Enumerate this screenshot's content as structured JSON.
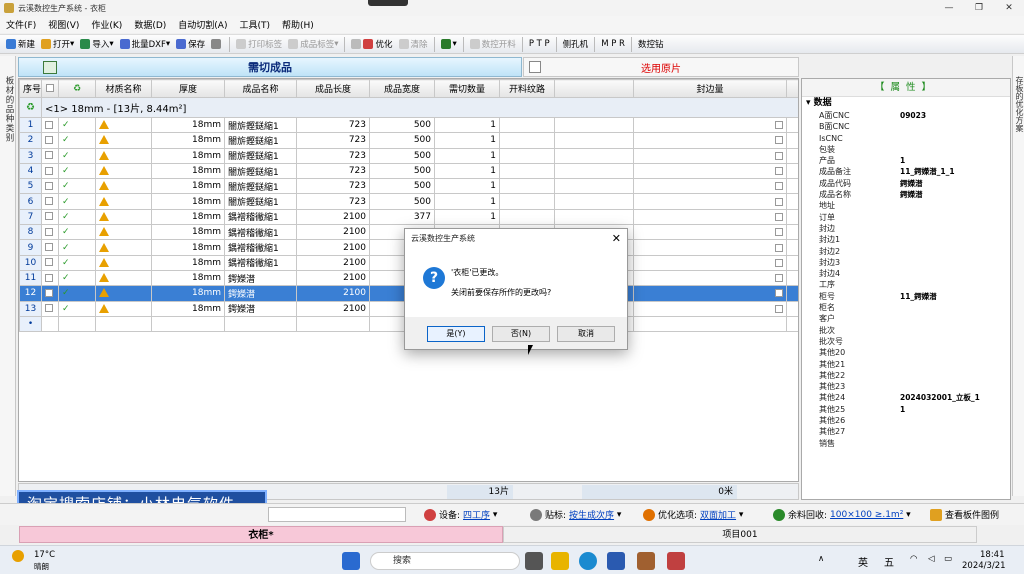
{
  "window": {
    "title": "云溪数控生产系统 - 衣柜",
    "controls": [
      "—",
      "❐",
      "✕"
    ]
  },
  "menu": [
    "文件(F)",
    "视图(V)",
    "作业(K)",
    "数据(D)",
    "自动切割(A)",
    "工具(T)",
    "帮助(H)"
  ],
  "toolbar": [
    {
      "label": "新建",
      "color": "#3a7bd5",
      "disabled": false
    },
    {
      "label": "打开",
      "color": "#e0a020",
      "disabled": false
    },
    {
      "label": "导入",
      "color": "#2a8a4a",
      "disabled": false
    },
    {
      "label": "批量DXF",
      "color": "#4a6ad0",
      "disabled": false
    },
    {
      "label": "保存",
      "color": "#4a6ad0",
      "disabled": false
    },
    {
      "label": "打印标签",
      "color": "#aaaaaa",
      "disabled": true
    },
    {
      "label": "成品标签",
      "color": "#aaaaaa",
      "disabled": true
    },
    {
      "label": "优化",
      "color": "#d04040",
      "disabled": false
    },
    {
      "label": "清除",
      "color": "#aaaaaa",
      "disabled": true
    },
    {
      "label": "数控开料",
      "color": "#aaaaaa",
      "disabled": true
    },
    {
      "label": "P T P",
      "color": "",
      "disabled": false
    },
    {
      "label": "侧孔机",
      "color": "",
      "disabled": false
    },
    {
      "label": "M P R",
      "color": "",
      "disabled": false
    },
    {
      "label": "数控钻",
      "color": "",
      "disabled": false
    }
  ],
  "side_tabs": {
    "left": "板材的品种类别",
    "right": "存板的优化方案"
  },
  "grid_header": {
    "title": "需切成品",
    "right_title": "选用原片"
  },
  "columns": [
    "序号",
    "材质名称",
    "厚度",
    "成品名称",
    "成品长度",
    "成品宽度",
    "需切数量",
    "开料纹路",
    "封边量"
  ],
  "group_label": "<1> 18mm - [13片, 8.44m²]",
  "rows": [
    {
      "n": "1",
      "thick": "18mm",
      "name": "闇旂鏗鎹縮1",
      "len": "723",
      "wid": "500",
      "qty": "1"
    },
    {
      "n": "2",
      "thick": "18mm",
      "name": "闇旂鏗鎹縮1",
      "len": "723",
      "wid": "500",
      "qty": "1"
    },
    {
      "n": "3",
      "thick": "18mm",
      "name": "闇旂鏗鎹縮1",
      "len": "723",
      "wid": "500",
      "qty": "1"
    },
    {
      "n": "4",
      "thick": "18mm",
      "name": "闇旂鏗鎹縮1",
      "len": "723",
      "wid": "500",
      "qty": "1"
    },
    {
      "n": "5",
      "thick": "18mm",
      "name": "闇旂鏗鎹縮1",
      "len": "723",
      "wid": "500",
      "qty": "1"
    },
    {
      "n": "6",
      "thick": "18mm",
      "name": "闇旂鏗鎹縮1",
      "len": "723",
      "wid": "500",
      "qty": "1"
    },
    {
      "n": "7",
      "thick": "18mm",
      "name": "鍝䙢稽徶縮1",
      "len": "2100",
      "wid": "377",
      "qty": "1"
    },
    {
      "n": "8",
      "thick": "18mm",
      "name": "鍝䙢稽徶縮1",
      "len": "2100",
      "wid": "",
      "qty": ""
    },
    {
      "n": "9",
      "thick": "18mm",
      "name": "鍝䙢稽徶縮1",
      "len": "2100",
      "wid": "",
      "qty": ""
    },
    {
      "n": "10",
      "thick": "18mm",
      "name": "鍝䙢稽徶縮1",
      "len": "2100",
      "wid": "",
      "qty": ""
    },
    {
      "n": "11",
      "thick": "18mm",
      "name": "鍔嬫澘",
      "len": "2100",
      "wid": "",
      "qty": ""
    },
    {
      "n": "12",
      "thick": "18mm",
      "name": "鍔嬫澘",
      "len": "2100",
      "wid": "",
      "qty": ""
    },
    {
      "n": "13",
      "thick": "18mm",
      "name": "鍔嬫澘",
      "len": "2100",
      "wid": "",
      "qty": ""
    }
  ],
  "new_row_marker": "•",
  "footer": {
    "pieces": "13片",
    "meters": "0米"
  },
  "watermark": "淘宝搜索店铺：小林电气软件",
  "status": {
    "device_label": "设备:",
    "device_value": "四工序",
    "label_label": "贴标:",
    "label_value": "按生成次序",
    "opt_label": "优化选项:",
    "opt_value": "双面加工",
    "scrap_label": "余料回收:",
    "scrap_value": "100×100 ≥.1m²",
    "view_sheet": "查看板件图例"
  },
  "bottom_tabs": [
    "衣柜*",
    "项目001"
  ],
  "properties": {
    "header": "【属性】",
    "section": "数据",
    "items": [
      {
        "k": "A面CNC",
        "v": "09023"
      },
      {
        "k": "B面CNC",
        "v": ""
      },
      {
        "k": "IsCNC",
        "v": ""
      },
      {
        "k": "包装",
        "v": ""
      },
      {
        "k": "产品",
        "v": "1"
      },
      {
        "k": "成品备注",
        "v": "11_鍔嬫澘_1_1"
      },
      {
        "k": "成品代码",
        "v": "鍔嬫澘"
      },
      {
        "k": "成品名称",
        "v": "鍔嬫澘"
      },
      {
        "k": "地址",
        "v": ""
      },
      {
        "k": "订单",
        "v": ""
      },
      {
        "k": "封边",
        "v": ""
      },
      {
        "k": "封边1",
        "v": ""
      },
      {
        "k": "封边2",
        "v": ""
      },
      {
        "k": "封边3",
        "v": ""
      },
      {
        "k": "封边4",
        "v": ""
      },
      {
        "k": "工序",
        "v": ""
      },
      {
        "k": "柜号",
        "v": "11_鍔嬫澘"
      },
      {
        "k": "柜名",
        "v": ""
      },
      {
        "k": "客户",
        "v": ""
      },
      {
        "k": "批次",
        "v": ""
      },
      {
        "k": "批次号",
        "v": ""
      },
      {
        "k": "其他20",
        "v": ""
      },
      {
        "k": "其他21",
        "v": ""
      },
      {
        "k": "其他22",
        "v": ""
      },
      {
        "k": "其他23",
        "v": ""
      },
      {
        "k": "其他24",
        "v": "2024032001_立板_1"
      },
      {
        "k": "其他25",
        "v": "1"
      },
      {
        "k": "其他26",
        "v": ""
      },
      {
        "k": "其他27",
        "v": ""
      },
      {
        "k": "销售",
        "v": ""
      }
    ]
  },
  "dialog": {
    "title": "云溪数控生产系统",
    "line1": "'衣柜'已更改。",
    "line2": "关闭前要保存所作的更改吗?",
    "yes": "是(Y)",
    "no": "否(N)",
    "cancel": "取消"
  },
  "taskbar": {
    "weather_temp": "17°C",
    "weather_text": "晴朗",
    "search": "搜索",
    "ime1": "英",
    "ime2": "五",
    "time": "18:41",
    "date": "2024/3/21"
  }
}
